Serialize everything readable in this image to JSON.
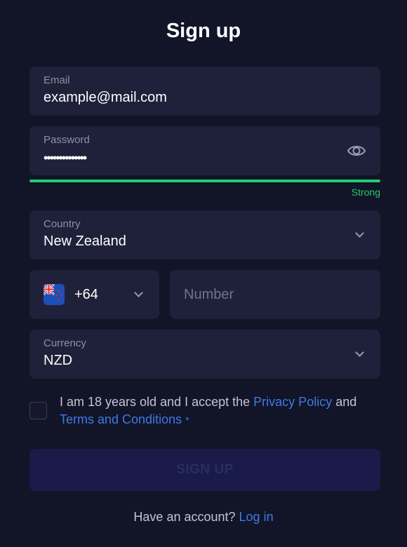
{
  "title": "Sign up",
  "email": {
    "label": "Email",
    "value": "example@mail.com"
  },
  "password": {
    "label": "Password",
    "value": "••••••••••••••",
    "strength": "Strong",
    "strength_fraction": 1.0,
    "visibility_icon": "eye-icon"
  },
  "country": {
    "label": "Country",
    "value": "New Zealand"
  },
  "phone": {
    "flag_icon": "new-zealand-flag-icon",
    "code": "+64",
    "number_placeholder": "Number"
  },
  "currency": {
    "label": "Currency",
    "value": "NZD"
  },
  "consent": {
    "prefix": "I am 18 years old and I accept the ",
    "privacy_link": "Privacy Policy",
    "middle": " and",
    "terms_link": "Terms and Conditions",
    "required_mark": "*"
  },
  "signup_button": "SIGN UP",
  "footer": {
    "text": "Have an account? ",
    "login_link": "Log in"
  },
  "colors": {
    "background": "#121428",
    "field": "#1f2039",
    "accent_link": "#3d7ae6",
    "strength_green": "#22cc6e",
    "button_disabled": "#1a1b4a"
  }
}
